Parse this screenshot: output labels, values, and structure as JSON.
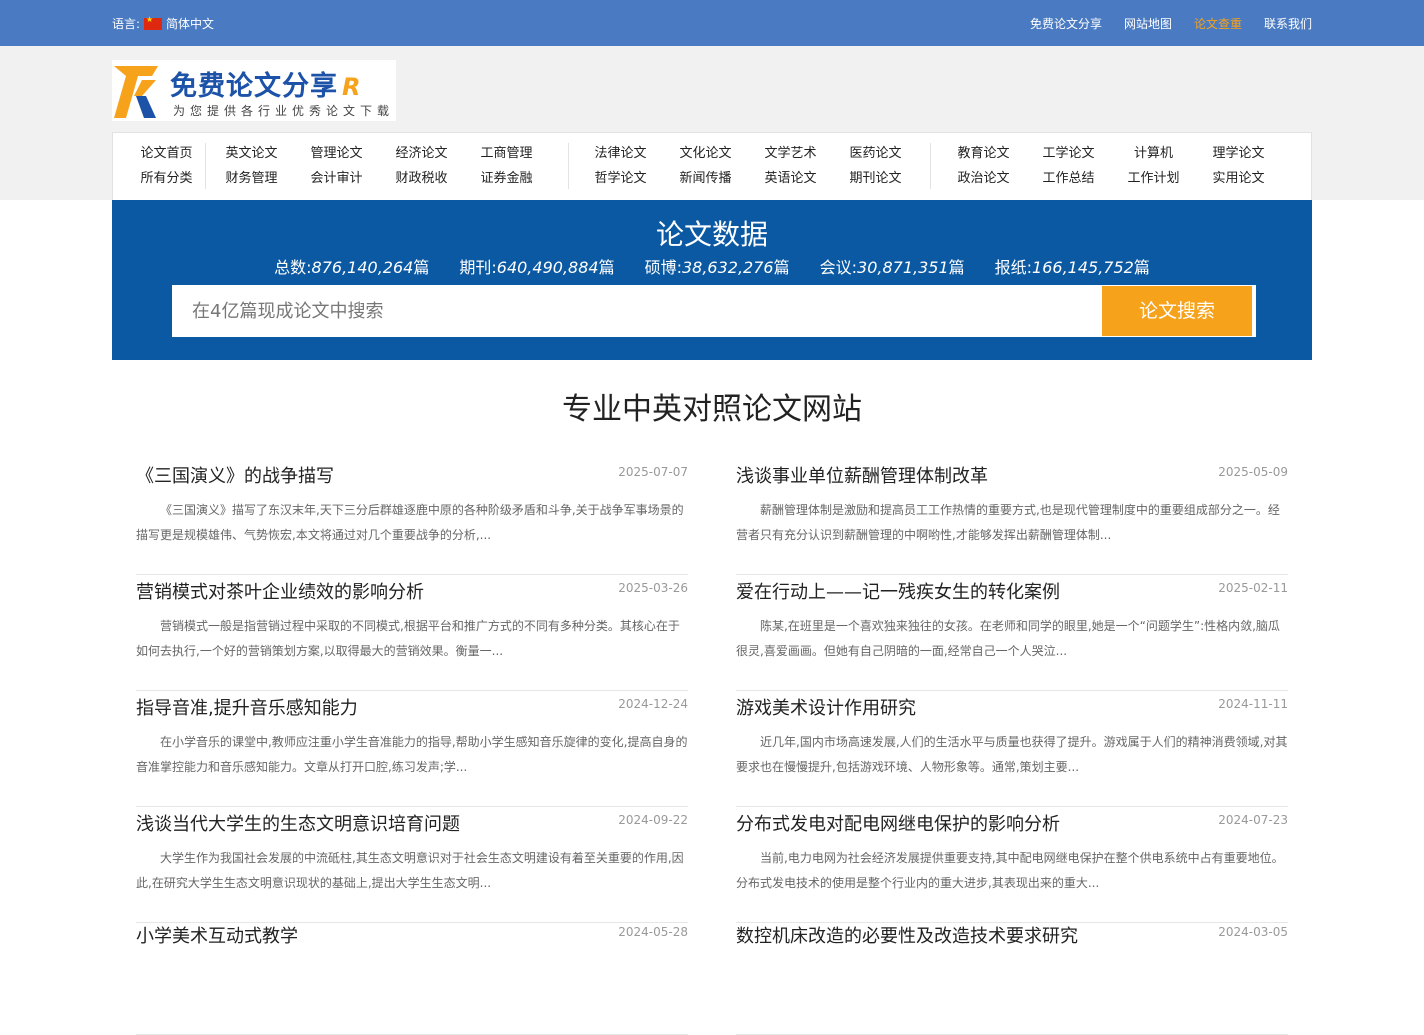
{
  "topbar": {
    "lang_label": "语言:",
    "lang_value": "简体中文",
    "nav": [
      "免费论文分享",
      "网站地图",
      "论文查重",
      "联系我们"
    ]
  },
  "logo": {
    "title": "免费论文分享",
    "subtitle": "为您提供各行业优秀论文下载"
  },
  "categories": {
    "group1": [
      "论文首页",
      "所有分类",
      "英文论文",
      "财务管理",
      "管理论文",
      "会计审计",
      "经济论文",
      "财政税收",
      "工商管理",
      "证券金融"
    ],
    "group2": [
      "法律论文",
      "哲学论文",
      "文化论文",
      "新闻传播",
      "文学艺术",
      "英语论文",
      "医药论文",
      "期刊论文"
    ],
    "group3": [
      "教育论文",
      "政治论文",
      "工学论文",
      "工作总结",
      "计算机",
      "工作计划",
      "理学论文",
      "实用论文"
    ]
  },
  "hero": {
    "title": "论文数据",
    "stats": [
      {
        "label": "总数:",
        "value": "876,140,264",
        "unit": "篇"
      },
      {
        "label": "期刊:",
        "value": "640,490,884",
        "unit": "篇"
      },
      {
        "label": "硕博:",
        "value": "38,632,276",
        "unit": "篇"
      },
      {
        "label": "会议:",
        "value": "30,871,351",
        "unit": "篇"
      },
      {
        "label": "报纸:",
        "value": "166,145,752",
        "unit": "篇"
      }
    ],
    "search_placeholder": "在4亿篇现成论文中搜索",
    "search_button": "论文搜索"
  },
  "section_title": "专业中英对照论文网站",
  "articles": [
    {
      "title": "《三国演义》的战争描写",
      "date": "2025-07-07",
      "desc": "《三国演义》描写了东汉末年,天下三分后群雄逐鹿中原的各种阶级矛盾和斗争,关于战争军事场景的描写更是规模雄伟、气势恢宏,本文将通过对几个重要战争的分析,..."
    },
    {
      "title": "浅谈事业单位薪酬管理体制改革",
      "date": "2025-05-09",
      "desc": "薪酬管理体制是激励和提高员工工作热情的重要方式,也是现代管理制度中的重要组成部分之一。经营者只有充分认识到薪酬管理的中啊哟性,才能够发挥出薪酬管理体制..."
    },
    {
      "title": "营销模式对茶叶企业绩效的影响分析",
      "date": "2025-03-26",
      "desc": "营销模式一般是指营销过程中采取的不同模式,根据平台和推广方式的不同有多种分类。其核心在于如何去执行,一个好的营销策划方案,以取得最大的营销效果。衡量一..."
    },
    {
      "title": "爱在行动上——记一残疾女生的转化案例",
      "date": "2025-02-11",
      "desc": "陈某,在班里是一个喜欢独来独往的女孩。在老师和同学的眼里,她是一个“问题学生”:性格内敛,脑瓜很灵,喜爱画画。但她有自己阴暗的一面,经常自己一个人哭泣..."
    },
    {
      "title": "指导音准,提升音乐感知能力",
      "date": "2024-12-24",
      "desc": "在小学音乐的课堂中,教师应注重小学生音准能力的指导,帮助小学生感知音乐旋律的变化,提高自身的音准掌控能力和音乐感知能力。文章从打开口腔,练习发声;学..."
    },
    {
      "title": "游戏美术设计作用研究",
      "date": "2024-11-11",
      "desc": "近几年,国内市场高速发展,人们的生活水平与质量也获得了提升。游戏属于人们的精神消费领域,对其要求也在慢慢提升,包括游戏环境、人物形象等。通常,策划主要..."
    },
    {
      "title": "浅谈当代大学生的生态文明意识培育问题",
      "date": "2024-09-22",
      "desc": "大学生作为我国社会发展的中流砥柱,其生态文明意识对于社会生态文明建设有着至关重要的作用,因此,在研究大学生生态文明意识现状的基础上,提出大学生生态文明..."
    },
    {
      "title": "分布式发电对配电网继电保护的影响分析",
      "date": "2024-07-23",
      "desc": "当前,电力电网为社会经济发展提供重要支持,其中配电网继电保护在整个供电系统中占有重要地位。分布式发电技术的使用是整个行业内的重大进步,其表现出来的重大..."
    },
    {
      "title": "小学美术互动式教学",
      "date": "2024-05-28",
      "desc": ""
    },
    {
      "title": "数控机床改造的必要性及改造技术要求研究",
      "date": "2024-03-05",
      "desc": ""
    }
  ]
}
